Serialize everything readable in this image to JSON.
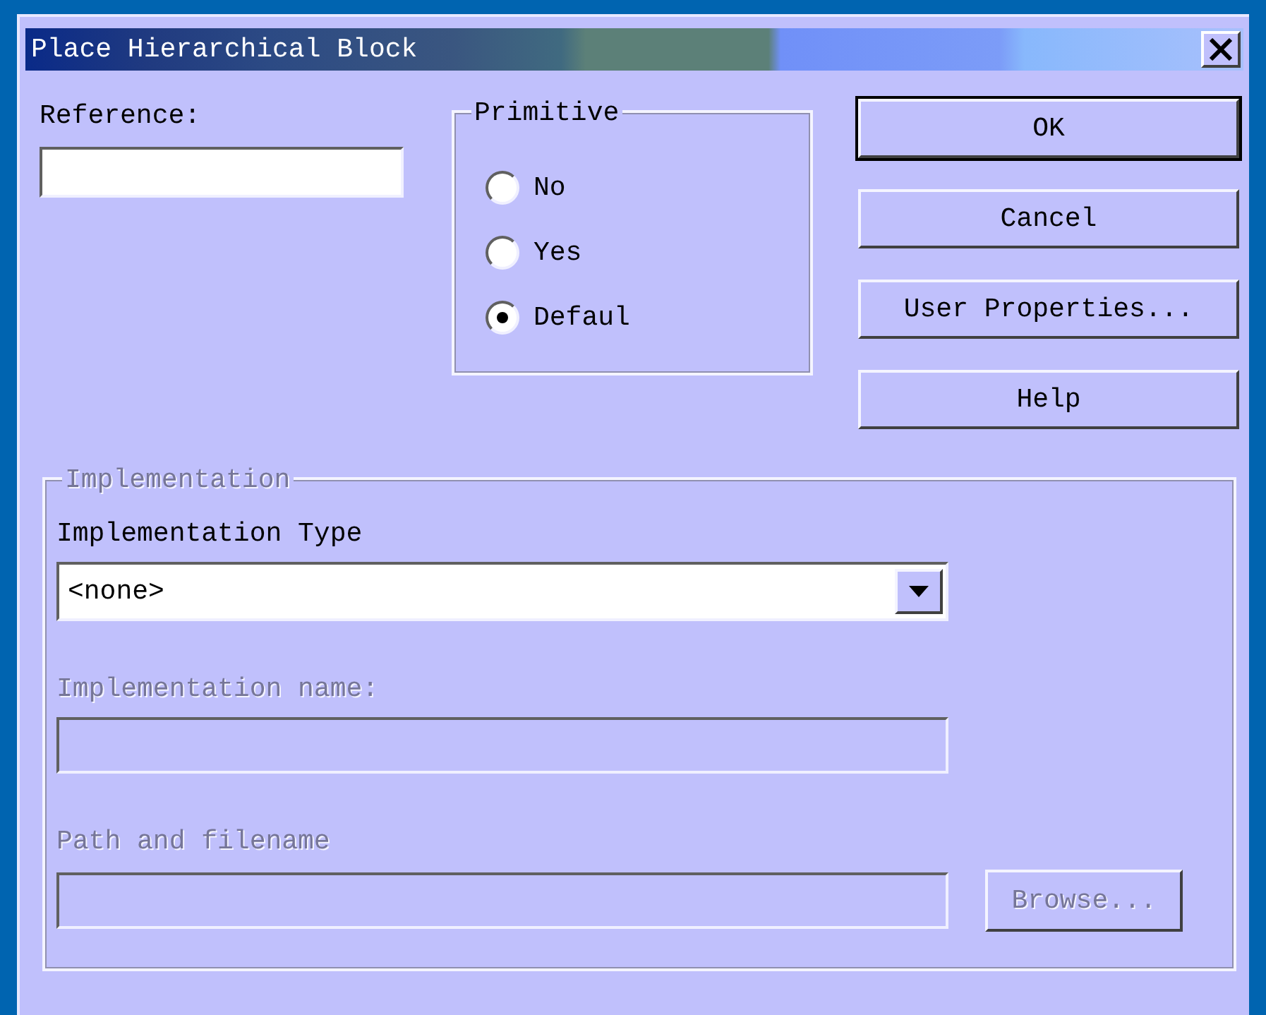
{
  "window": {
    "title": "Place Hierarchical Block"
  },
  "reference": {
    "label": "Reference:"
  },
  "primitive": {
    "title": "Primitive",
    "options": [
      {
        "label": "No",
        "selected": false
      },
      {
        "label": "Yes",
        "selected": false
      },
      {
        "label": "Defaul",
        "selected": true
      }
    ]
  },
  "buttons": [
    {
      "label": "OK",
      "default": true
    },
    {
      "label": "Cancel",
      "default": false
    },
    {
      "label": "User Properties...",
      "default": false
    },
    {
      "label": "Help",
      "default": false
    }
  ],
  "implementation": {
    "title": "Implementation",
    "disabled": true,
    "fields": [
      {
        "kind": "dropdown",
        "label": "Implementation Type",
        "value": "<none>",
        "disabled": false
      },
      {
        "kind": "text",
        "label": "Implementation name:",
        "disabled": true
      },
      {
        "kind": "text",
        "label": "Path and filename",
        "disabled": true,
        "button": {
          "label": "Browse...",
          "disabled": true
        }
      }
    ]
  }
}
